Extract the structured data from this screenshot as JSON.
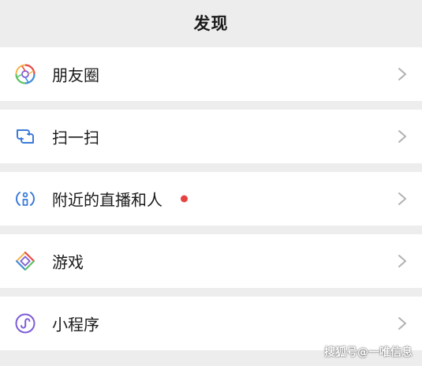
{
  "header": {
    "title": "发现"
  },
  "items": [
    {
      "label": "朋友圈",
      "icon": "moments-icon"
    },
    {
      "label": "扫一扫",
      "icon": "scan-icon"
    },
    {
      "label": "附近的直播和人",
      "icon": "nearby-icon",
      "has_badge_dot": true
    },
    {
      "label": "游戏",
      "icon": "games-icon"
    },
    {
      "label": "小程序",
      "icon": "mini-program-icon"
    }
  ],
  "colors": {
    "background": "#ededed",
    "row_background": "#ffffff",
    "badge_dot": "#e64340",
    "chevron": "#b2b2b2",
    "text": "#1a1a1a"
  },
  "watermark": {
    "text": "搜狐号@一唯信息"
  }
}
